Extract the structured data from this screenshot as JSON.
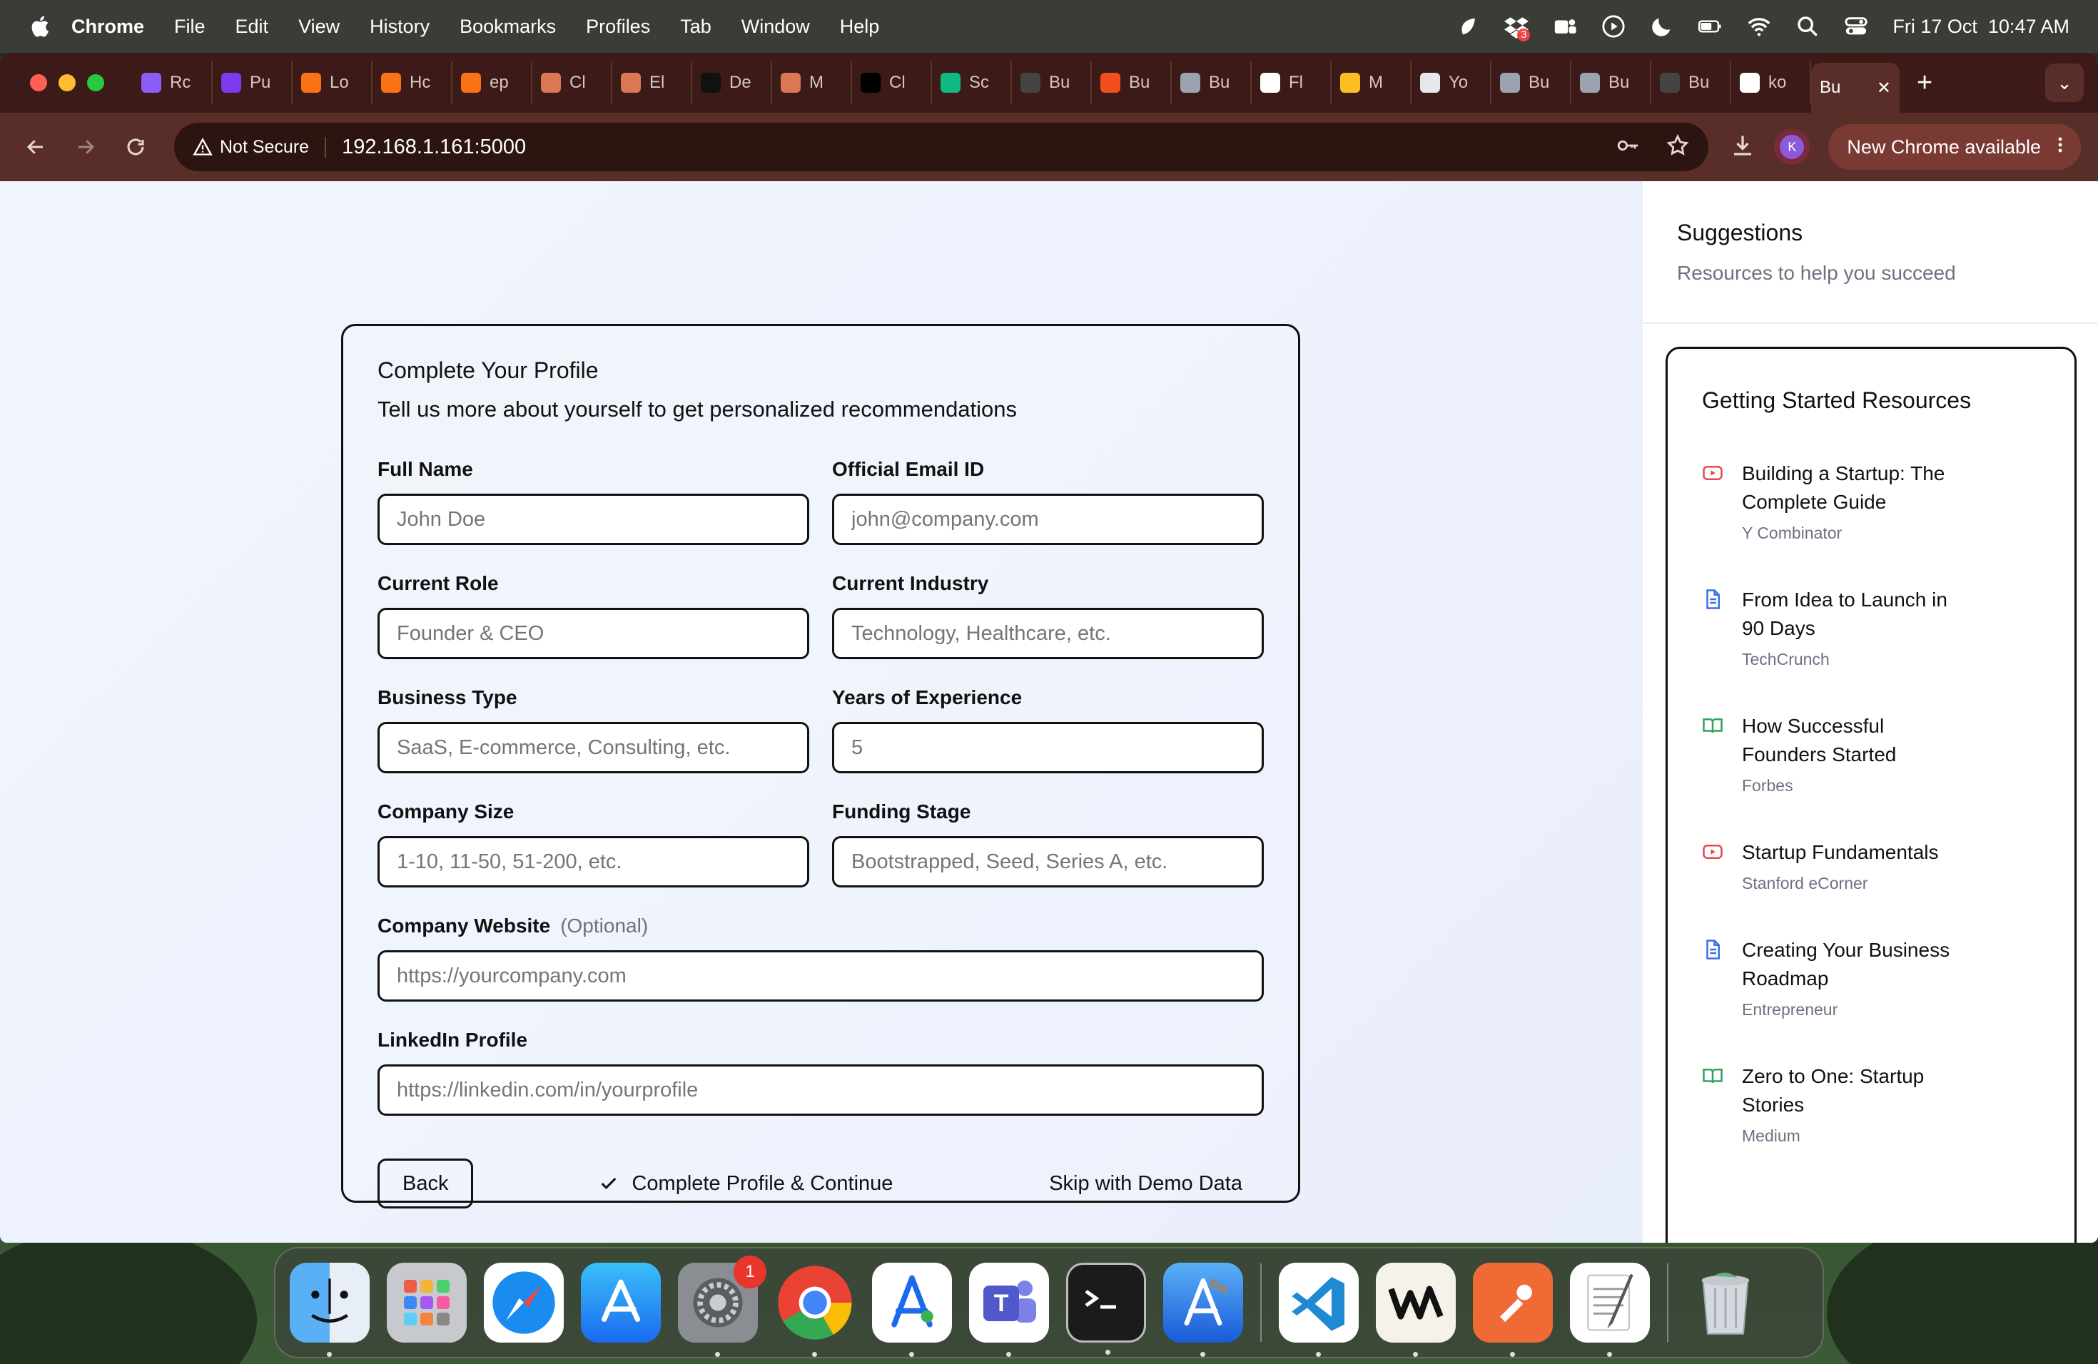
{
  "menubar": {
    "app_name": "Chrome",
    "menus": [
      "File",
      "Edit",
      "View",
      "History",
      "Bookmarks",
      "Profiles",
      "Tab",
      "Window",
      "Help"
    ],
    "notification_count": "3",
    "datetime": "Fri 17 Oct  10:47 AM"
  },
  "tabs": {
    "items": [
      {
        "label": "Rc",
        "color": "#8b5cf6"
      },
      {
        "label": "Pu",
        "color": "#7c3aed"
      },
      {
        "label": "Lo",
        "color": "#f97316"
      },
      {
        "label": "Hc",
        "color": "#f97316"
      },
      {
        "label": "ep",
        "color": "#f97316"
      },
      {
        "label": "Cl",
        "color": "#d97757"
      },
      {
        "label": "El",
        "color": "#d97757"
      },
      {
        "label": "De",
        "color": "#111111"
      },
      {
        "label": "M",
        "color": "#d97757"
      },
      {
        "label": "Cl",
        "color": "#000000"
      },
      {
        "label": "Sc",
        "color": "#10b981"
      },
      {
        "label": "Bu",
        "color": "#444444"
      },
      {
        "label": "Bu",
        "color": "#f24e1e"
      },
      {
        "label": "Bu",
        "color": "#9ca3af"
      },
      {
        "label": "Fl",
        "color": "#ffffff"
      },
      {
        "label": "M",
        "color": "#fbbf24"
      },
      {
        "label": "Yo",
        "color": "#e5e7eb"
      },
      {
        "label": "Bu",
        "color": "#9ca3af"
      },
      {
        "label": "Bu",
        "color": "#9ca3af"
      },
      {
        "label": "Bu",
        "color": "#444444"
      },
      {
        "label": "ko",
        "color": "#ffffff"
      }
    ],
    "active": {
      "label": "Bu",
      "close": "✕"
    },
    "add": "+",
    "menu": "⌄"
  },
  "toolbar": {
    "not_secure": "Not Secure",
    "url": "192.168.1.161:5000",
    "avatar_initial": "K",
    "update_label": "New Chrome available"
  },
  "form": {
    "title": "Complete Your Profile",
    "subtitle": "Tell us more about yourself to get personalized recommendations",
    "fields": {
      "full_name": {
        "label": "Full Name",
        "placeholder": "John Doe"
      },
      "email": {
        "label": "Official Email ID",
        "placeholder": "john@company.com"
      },
      "role": {
        "label": "Current Role",
        "placeholder": "Founder & CEO"
      },
      "industry": {
        "label": "Current Industry",
        "placeholder": "Technology, Healthcare, etc."
      },
      "business_type": {
        "label": "Business Type",
        "placeholder": "SaaS, E-commerce, Consulting, etc."
      },
      "experience": {
        "label": "Years of Experience",
        "placeholder": "5"
      },
      "company_size": {
        "label": "Company Size",
        "placeholder": "1-10, 11-50, 51-200, etc."
      },
      "funding_stage": {
        "label": "Funding Stage",
        "placeholder": "Bootstrapped, Seed, Series A, etc."
      },
      "website": {
        "label": "Company Website",
        "optional": "(Optional)",
        "placeholder": "https://yourcompany.com"
      },
      "linkedin": {
        "label": "LinkedIn Profile",
        "placeholder": "https://linkedin.com/in/yourprofile"
      }
    },
    "back_label": "Back",
    "complete_label": "Complete Profile & Continue",
    "skip_label": "Skip with Demo Data"
  },
  "sidebar": {
    "title": "Suggestions",
    "subtitle": "Resources to help you succeed",
    "resources_title": "Getting Started Resources",
    "resources": [
      {
        "icon": "video-icon",
        "line1": "Building a Startup: The",
        "line2": "Complete Guide",
        "source": "Y Combinator"
      },
      {
        "icon": "document-icon",
        "line1": "From Idea to Launch in",
        "line2": "90 Days",
        "source": "TechCrunch"
      },
      {
        "icon": "book-icon",
        "line1": "How Successful",
        "line2": "Founders Started",
        "source": "Forbes"
      },
      {
        "icon": "video-icon",
        "line1": "Startup Fundamentals",
        "line2": "",
        "source": "Stanford eCorner"
      },
      {
        "icon": "document-icon",
        "line1": "Creating Your Business",
        "line2": "Roadmap",
        "source": "Entrepreneur"
      },
      {
        "icon": "book-icon",
        "line1": "Zero to One: Startup",
        "line2": "Stories",
        "source": "Medium"
      }
    ]
  },
  "dock": {
    "settings_badge": "1"
  }
}
